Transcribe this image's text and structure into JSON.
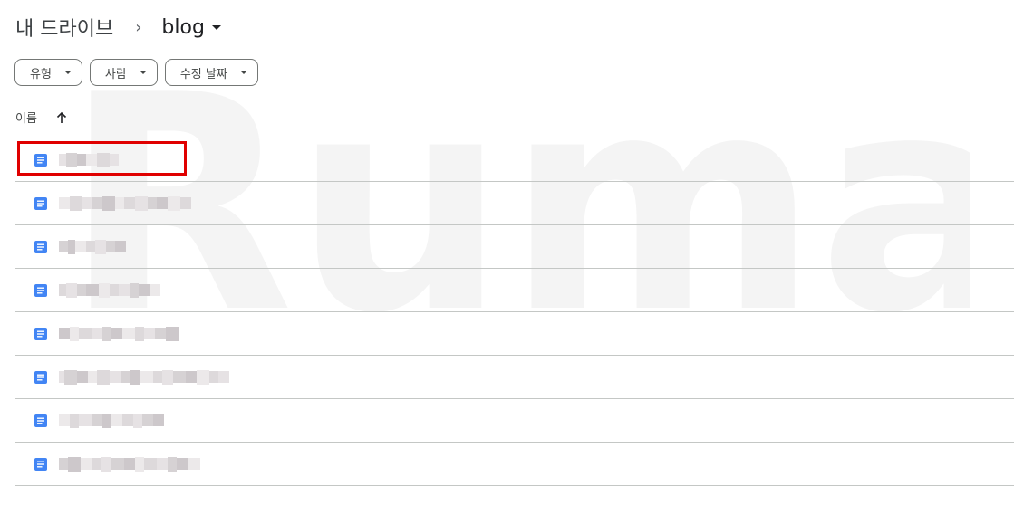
{
  "breadcrumb": {
    "root": "내 드라이브",
    "separator": "›",
    "current": "blog"
  },
  "filters": [
    {
      "label": "유형"
    },
    {
      "label": "사람"
    },
    {
      "label": "수정 날짜"
    }
  ],
  "list": {
    "sort_column": "이름",
    "sort_direction_icon": "arrow-up-icon",
    "item_icon": "google-docs-icon",
    "items": [
      {
        "name": "",
        "redacted": true,
        "highlighted": true
      },
      {
        "name": "",
        "redacted": true
      },
      {
        "name": "",
        "redacted": true
      },
      {
        "name": "",
        "redacted": true
      },
      {
        "name": "",
        "redacted": true
      },
      {
        "name": "",
        "redacted": true
      },
      {
        "name": "",
        "redacted": true
      },
      {
        "name": "",
        "redacted": true
      }
    ]
  },
  "watermark": "Ruma",
  "colors": {
    "doc_icon": "#4285f4",
    "highlight": "#e00000",
    "divider": "#c4c7c5"
  }
}
